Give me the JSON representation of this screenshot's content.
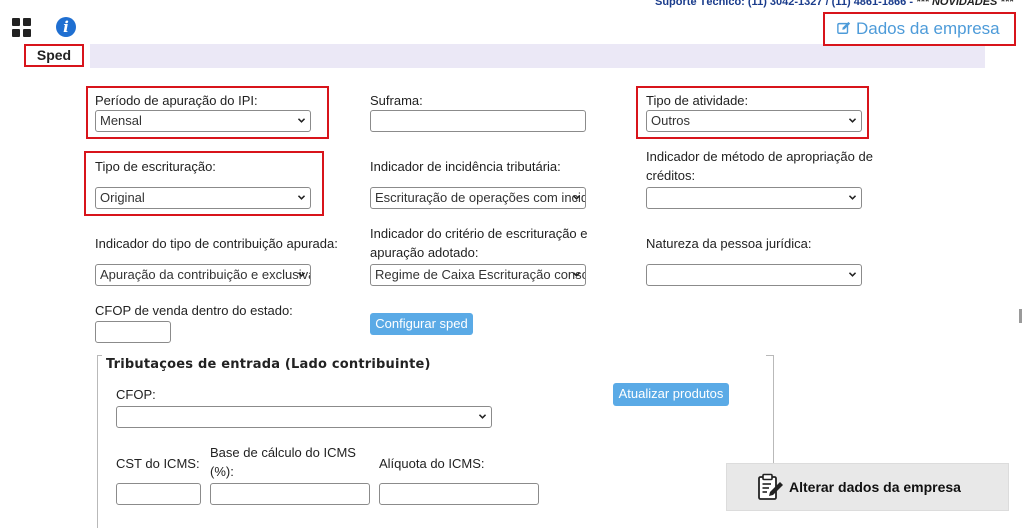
{
  "header": {
    "support_text": "Suporte Técnico: (11) 3042-1327 / (11) 4861-1866 - ",
    "novidades_text": "*** NOVIDADES ***",
    "tab_label": "Sped",
    "company_link": "Dados da empresa"
  },
  "form": {
    "periodo_ipi": {
      "label": "Período de apuração do IPI:",
      "value": "Mensal"
    },
    "suframa": {
      "label": "Suframa:",
      "value": ""
    },
    "tipo_atividade": {
      "label": "Tipo de atividade:",
      "value": "Outros"
    },
    "tipo_escrituracao": {
      "label": "Tipo de escrituração:",
      "value": "Original"
    },
    "incidencia": {
      "label": "Indicador de incidência tributária:",
      "value": "Escrituração de operações com incidência"
    },
    "metodo_apropriacao": {
      "label_line1": "Indicador de método de apropriação de",
      "label_line2": "créditos:",
      "value": ""
    },
    "tipo_contribuicao": {
      "label": "Indicador do tipo de contribuição apurada:",
      "value": "Apuração da contribuição e exclusiva"
    },
    "criterio_escrituracao": {
      "label_line1": "Indicador do critério de escrituração e",
      "label_line2": "apuração adotado:",
      "value": "Regime de Caixa Escrituração consolidada"
    },
    "natureza_pessoa": {
      "label": "Natureza da pessoa jurídica:",
      "value": ""
    },
    "cfop_venda": {
      "label": "CFOP de venda dentro do estado:",
      "value": ""
    },
    "configurar_button": "Configurar sped"
  },
  "entrada": {
    "title": "Tributaçoes de entrada (Lado contribuinte)",
    "cfop": {
      "label": "CFOP:",
      "value": ""
    },
    "atualizar_button": "Atualizar produtos",
    "cst_icms": {
      "label": "CST do ICMS:",
      "value": ""
    },
    "base_calculo": {
      "label_line1": "Base de cálculo do ICMS",
      "label_line2": "(%):",
      "value": ""
    },
    "aliquota": {
      "label": "Alíquota do ICMS:",
      "value": ""
    }
  },
  "footer": {
    "alterar_button": "Alterar dados da empresa"
  },
  "colors": {
    "highlight_red": "#d8141b",
    "link_blue": "#4d9bd9",
    "button_blue": "#5aaae6",
    "band_lavender": "#ebe8f6"
  }
}
